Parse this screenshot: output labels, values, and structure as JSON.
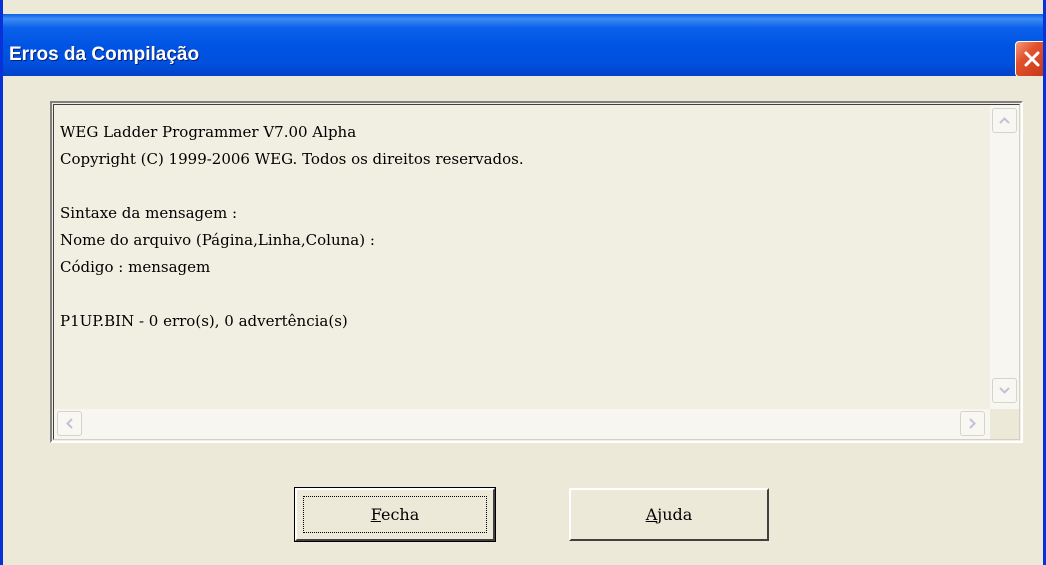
{
  "window": {
    "title": "Erros da Compilação",
    "close_icon": "close-icon"
  },
  "output": {
    "lines": [
      "WEG Ladder Programmer V7.00 Alpha",
      "Copyright (C) 1999-2006 WEG. Todos os direitos reservados.",
      "",
      "Sintaxe da mensagem :",
      "Nome do arquivo (Página,Linha,Coluna) :",
      "Código : mensagem",
      "",
      "P1UP.BIN - 0 erro(s), 0 advertência(s)"
    ]
  },
  "buttons": {
    "fecha": {
      "accel": "F",
      "rest": "echa"
    },
    "ajuda": {
      "accel": "A",
      "rest": "juda"
    }
  },
  "colors": {
    "title_bar": "#0054e3",
    "close_button": "#e2532c",
    "dialog_face": "#ece9d8"
  }
}
